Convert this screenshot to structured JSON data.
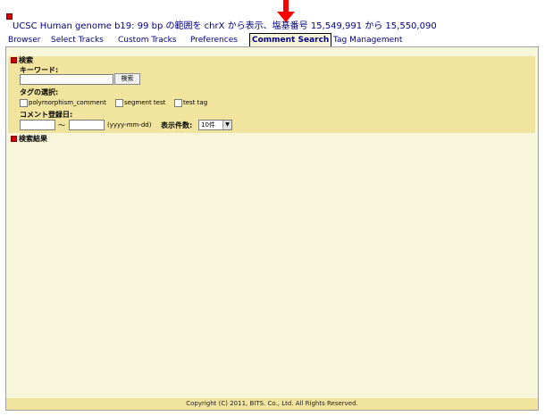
{
  "header": {
    "title": "UCSC Human genome b19: 99 bp の範囲を chrX から表示、塩基番号 15,549,991 から 15,550,090"
  },
  "tabs": [
    {
      "label": "Browser"
    },
    {
      "label": "Select Tracks"
    },
    {
      "label": "Custom Tracks"
    },
    {
      "label": "Preferences"
    },
    {
      "label": "Comment Search",
      "active": true
    },
    {
      "label": "Tag Management"
    }
  ],
  "search": {
    "section_title": "検索",
    "keyword_label": "キーワード:",
    "keyword_value": "",
    "search_button": "検索",
    "tag_label": "タグの選択:",
    "tags": [
      {
        "label": "polymorphism_comment",
        "checked": false
      },
      {
        "label": "segment test",
        "checked": false
      },
      {
        "label": "test tag",
        "checked": false
      }
    ],
    "date_label": "コメント登録日:",
    "date_from": "",
    "date_separator": "～",
    "date_to": "",
    "date_format_hint": "(yyyy-mm-dd)",
    "count_label": "表示件数:",
    "count_value": "10件"
  },
  "results": {
    "section_title": "検索結果"
  },
  "footer": {
    "copyright": "Copyright (C) 2011, BITS. Co., Ltd. All Rights Reserved."
  },
  "colors": {
    "panel_bg": "#f7f5da",
    "section_bg": "#f0e49e",
    "link": "#000088",
    "annotation_arrow": "#ff0000"
  }
}
